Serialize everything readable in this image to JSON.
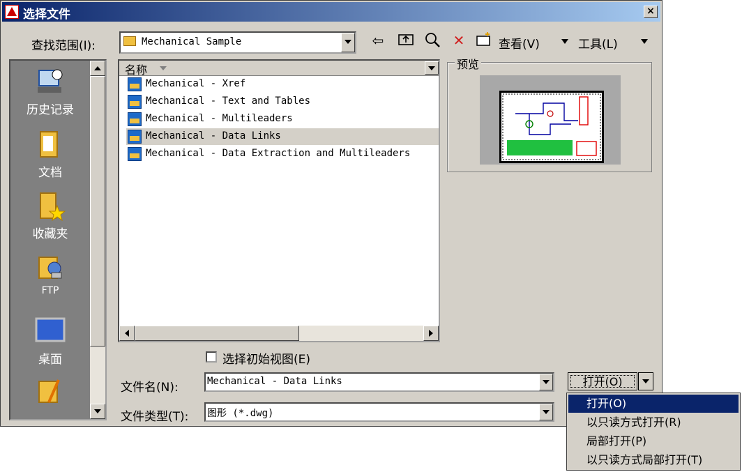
{
  "window": {
    "title": "选择文件",
    "close": "×"
  },
  "lookin": {
    "label": "查找范围(I):",
    "value": "Mechanical Sample"
  },
  "toolbar": {
    "back_icon": "back-arrow-icon",
    "up_icon": "up-folder-icon",
    "search_icon": "search-web-icon",
    "delete_icon": "delete-icon",
    "newfolder_icon": "new-folder-icon",
    "views_label": "查看(V)",
    "tools_label": "工具(L)"
  },
  "places": [
    {
      "label": "历史记录",
      "icon": "history-icon"
    },
    {
      "label": "文档",
      "icon": "documents-icon"
    },
    {
      "label": "收藏夹",
      "icon": "favorites-icon"
    },
    {
      "label": "FTP",
      "icon": "ftp-icon"
    },
    {
      "label": "桌面",
      "icon": "desktop-icon"
    },
    {
      "label": "",
      "icon": "buzzsaw-icon"
    }
  ],
  "list": {
    "column": "名称",
    "files": [
      "Mechanical - Xref",
      "Mechanical - Text and Tables",
      "Mechanical - Multileaders",
      "Mechanical - Data Links",
      "Mechanical - Data Extraction and Multileaders"
    ],
    "selected_index": 3
  },
  "preview": {
    "label": "预览"
  },
  "initial_view": {
    "label": "选择初始视图(E)",
    "checked": false
  },
  "filename": {
    "label": "文件名(N):",
    "value": "Mechanical - Data Links"
  },
  "filetype": {
    "label": "文件类型(T):",
    "value": "图形 (*.dwg)"
  },
  "open_button": {
    "label": "打开(O)"
  },
  "open_menu": [
    "打开(O)",
    "以只读方式打开(R)",
    "局部打开(P)",
    "以只读方式局部打开(T)"
  ],
  "colors": {
    "titlebar": "#0a246a",
    "dialog": "#d4d0c8",
    "highlight": "#0a246a"
  }
}
